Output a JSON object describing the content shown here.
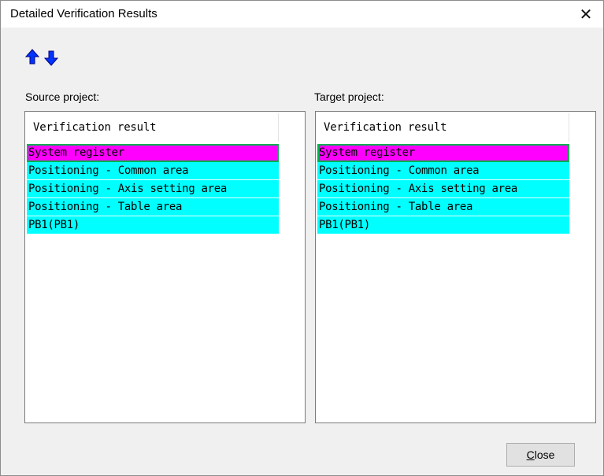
{
  "window": {
    "title": "Detailed Verification Results",
    "close_glyph": "✕"
  },
  "toolbar": {
    "up_icon": "arrow-up-icon",
    "down_icon": "arrow-down-icon",
    "arrow_color": "#0033ff"
  },
  "source": {
    "label": "Source project:",
    "header": "Verification result",
    "items": [
      {
        "text": "System register",
        "color": "#ff00ff",
        "selected": true
      },
      {
        "text": "Positioning - Common area",
        "color": "#00ffff",
        "selected": false
      },
      {
        "text": "Positioning - Axis setting area",
        "color": "#00ffff",
        "selected": false
      },
      {
        "text": "Positioning - Table area",
        "color": "#00ffff",
        "selected": false
      },
      {
        "text": "PB1(PB1)",
        "color": "#00ffff",
        "selected": false
      }
    ]
  },
  "target": {
    "label": "Target project:",
    "header": "Verification result",
    "items": [
      {
        "text": "System register",
        "color": "#ff00ff",
        "selected": true
      },
      {
        "text": "Positioning - Common area",
        "color": "#00ffff",
        "selected": false
      },
      {
        "text": "Positioning - Axis setting area",
        "color": "#00ffff",
        "selected": false
      },
      {
        "text": "Positioning - Table area",
        "color": "#00ffff",
        "selected": false
      },
      {
        "text": "PB1(PB1)",
        "color": "#00ffff",
        "selected": false
      }
    ]
  },
  "footer": {
    "close_accel": "C",
    "close_rest": "lose"
  }
}
